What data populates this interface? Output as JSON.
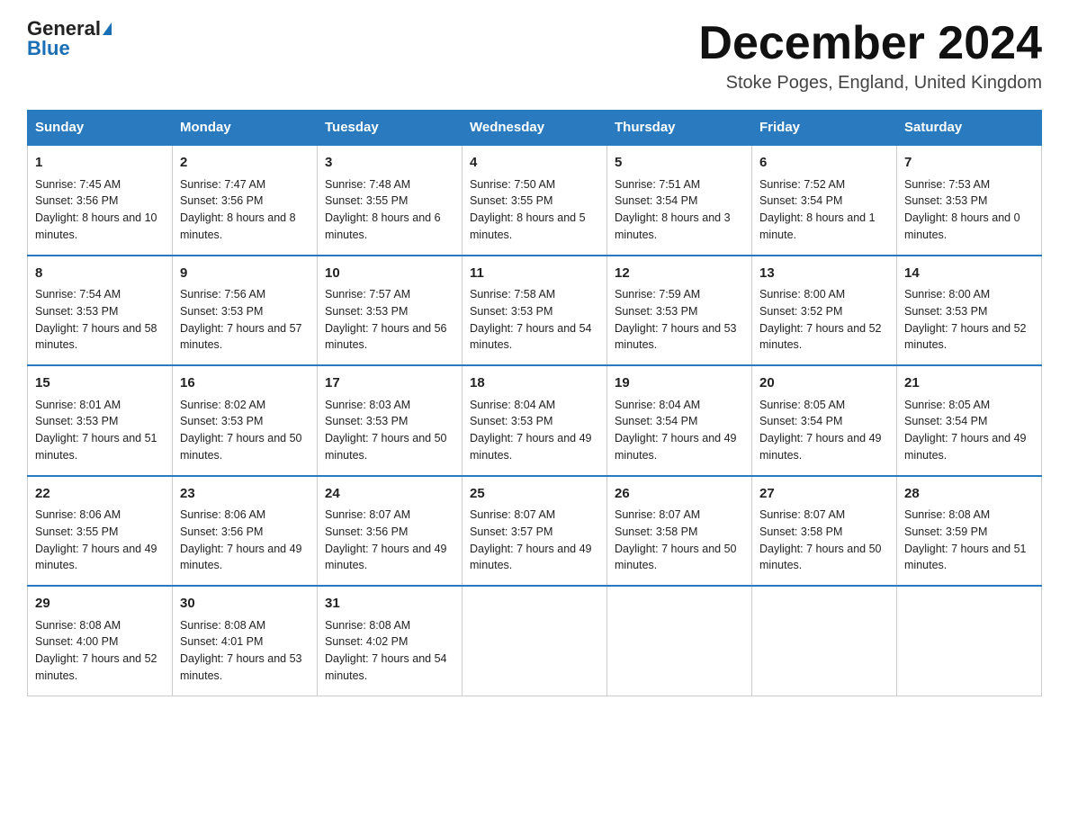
{
  "header": {
    "logo_line1": "General",
    "logo_line2": "Blue",
    "month": "December 2024",
    "location": "Stoke Poges, England, United Kingdom"
  },
  "days_of_week": [
    "Sunday",
    "Monday",
    "Tuesday",
    "Wednesday",
    "Thursday",
    "Friday",
    "Saturday"
  ],
  "weeks": [
    [
      {
        "day": "1",
        "sunrise": "7:45 AM",
        "sunset": "3:56 PM",
        "daylight": "8 hours and 10 minutes."
      },
      {
        "day": "2",
        "sunrise": "7:47 AM",
        "sunset": "3:56 PM",
        "daylight": "8 hours and 8 minutes."
      },
      {
        "day": "3",
        "sunrise": "7:48 AM",
        "sunset": "3:55 PM",
        "daylight": "8 hours and 6 minutes."
      },
      {
        "day": "4",
        "sunrise": "7:50 AM",
        "sunset": "3:55 PM",
        "daylight": "8 hours and 5 minutes."
      },
      {
        "day": "5",
        "sunrise": "7:51 AM",
        "sunset": "3:54 PM",
        "daylight": "8 hours and 3 minutes."
      },
      {
        "day": "6",
        "sunrise": "7:52 AM",
        "sunset": "3:54 PM",
        "daylight": "8 hours and 1 minute."
      },
      {
        "day": "7",
        "sunrise": "7:53 AM",
        "sunset": "3:53 PM",
        "daylight": "8 hours and 0 minutes."
      }
    ],
    [
      {
        "day": "8",
        "sunrise": "7:54 AM",
        "sunset": "3:53 PM",
        "daylight": "7 hours and 58 minutes."
      },
      {
        "day": "9",
        "sunrise": "7:56 AM",
        "sunset": "3:53 PM",
        "daylight": "7 hours and 57 minutes."
      },
      {
        "day": "10",
        "sunrise": "7:57 AM",
        "sunset": "3:53 PM",
        "daylight": "7 hours and 56 minutes."
      },
      {
        "day": "11",
        "sunrise": "7:58 AM",
        "sunset": "3:53 PM",
        "daylight": "7 hours and 54 minutes."
      },
      {
        "day": "12",
        "sunrise": "7:59 AM",
        "sunset": "3:53 PM",
        "daylight": "7 hours and 53 minutes."
      },
      {
        "day": "13",
        "sunrise": "8:00 AM",
        "sunset": "3:52 PM",
        "daylight": "7 hours and 52 minutes."
      },
      {
        "day": "14",
        "sunrise": "8:00 AM",
        "sunset": "3:53 PM",
        "daylight": "7 hours and 52 minutes."
      }
    ],
    [
      {
        "day": "15",
        "sunrise": "8:01 AM",
        "sunset": "3:53 PM",
        "daylight": "7 hours and 51 minutes."
      },
      {
        "day": "16",
        "sunrise": "8:02 AM",
        "sunset": "3:53 PM",
        "daylight": "7 hours and 50 minutes."
      },
      {
        "day": "17",
        "sunrise": "8:03 AM",
        "sunset": "3:53 PM",
        "daylight": "7 hours and 50 minutes."
      },
      {
        "day": "18",
        "sunrise": "8:04 AM",
        "sunset": "3:53 PM",
        "daylight": "7 hours and 49 minutes."
      },
      {
        "day": "19",
        "sunrise": "8:04 AM",
        "sunset": "3:54 PM",
        "daylight": "7 hours and 49 minutes."
      },
      {
        "day": "20",
        "sunrise": "8:05 AM",
        "sunset": "3:54 PM",
        "daylight": "7 hours and 49 minutes."
      },
      {
        "day": "21",
        "sunrise": "8:05 AM",
        "sunset": "3:54 PM",
        "daylight": "7 hours and 49 minutes."
      }
    ],
    [
      {
        "day": "22",
        "sunrise": "8:06 AM",
        "sunset": "3:55 PM",
        "daylight": "7 hours and 49 minutes."
      },
      {
        "day": "23",
        "sunrise": "8:06 AM",
        "sunset": "3:56 PM",
        "daylight": "7 hours and 49 minutes."
      },
      {
        "day": "24",
        "sunrise": "8:07 AM",
        "sunset": "3:56 PM",
        "daylight": "7 hours and 49 minutes."
      },
      {
        "day": "25",
        "sunrise": "8:07 AM",
        "sunset": "3:57 PM",
        "daylight": "7 hours and 49 minutes."
      },
      {
        "day": "26",
        "sunrise": "8:07 AM",
        "sunset": "3:58 PM",
        "daylight": "7 hours and 50 minutes."
      },
      {
        "day": "27",
        "sunrise": "8:07 AM",
        "sunset": "3:58 PM",
        "daylight": "7 hours and 50 minutes."
      },
      {
        "day": "28",
        "sunrise": "8:08 AM",
        "sunset": "3:59 PM",
        "daylight": "7 hours and 51 minutes."
      }
    ],
    [
      {
        "day": "29",
        "sunrise": "8:08 AM",
        "sunset": "4:00 PM",
        "daylight": "7 hours and 52 minutes."
      },
      {
        "day": "30",
        "sunrise": "8:08 AM",
        "sunset": "4:01 PM",
        "daylight": "7 hours and 53 minutes."
      },
      {
        "day": "31",
        "sunrise": "8:08 AM",
        "sunset": "4:02 PM",
        "daylight": "7 hours and 54 minutes."
      },
      null,
      null,
      null,
      null
    ]
  ]
}
